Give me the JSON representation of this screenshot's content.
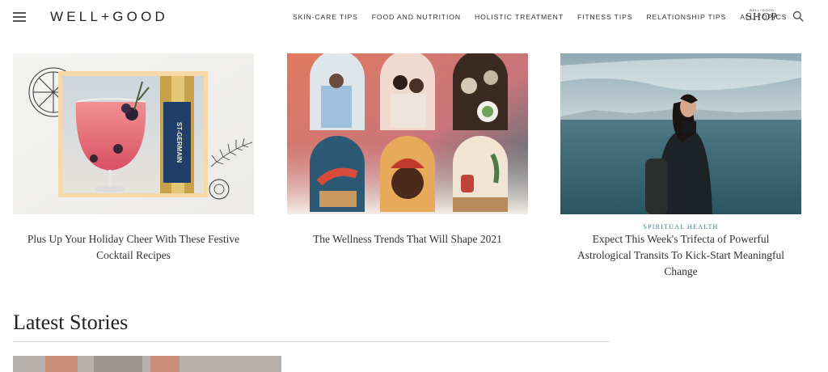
{
  "header": {
    "logo": "WELL+GOOD",
    "nav": [
      "SKIN-CARE TIPS",
      "FOOD AND NUTRITION",
      "HOLISTIC TREATMENT",
      "FITNESS TIPS",
      "RELATIONSHIP TIPS",
      "ALL TOPICS"
    ],
    "shop_top": "WELL+GOOD",
    "shop_word": "SHOP",
    "icons": {
      "menu": "hamburger-icon",
      "search": "search-icon"
    }
  },
  "cards": [
    {
      "category": "",
      "title": "Plus Up Your Holiday Cheer With These Festive Cocktail Recipes",
      "bottle_label": "ST-GERMAIN"
    },
    {
      "category": "",
      "title": "The Wellness Trends That Will Shape 2021"
    },
    {
      "category": "SPIRITUAL HEALTH",
      "title": "Expect This Week's Trifecta of Powerful Astrological Transits To Kick-Start Meaningful Change"
    }
  ],
  "latest": {
    "heading": "Latest Stories"
  },
  "colors": {
    "category_accent": "#4d7e88",
    "text": "#333333"
  }
}
